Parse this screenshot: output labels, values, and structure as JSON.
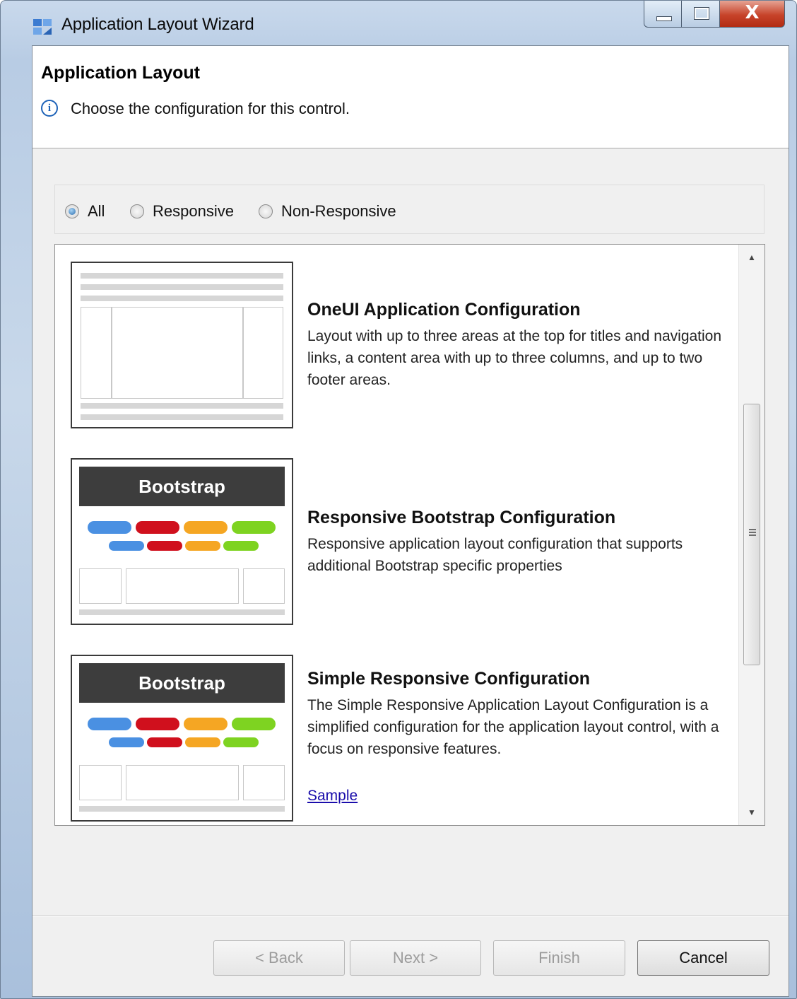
{
  "window": {
    "title": "Application Layout Wizard"
  },
  "caption": {
    "close_glyph": "X"
  },
  "header": {
    "title": "Application Layout",
    "info_glyph": "i",
    "message": "Choose the configuration for this control."
  },
  "filter": {
    "options": [
      {
        "label": "All",
        "selected": true
      },
      {
        "label": "Responsive",
        "selected": false
      },
      {
        "label": "Non-Responsive",
        "selected": false
      }
    ]
  },
  "configurations": [
    {
      "title": "OneUI Application Configuration",
      "description": "Layout with up to three areas at the top for titles and navigation links, a content area with up to three columns, and up to two footer areas.",
      "thumbnail": "oneui-layout-thumbnail"
    },
    {
      "title": "Responsive Bootstrap Configuration",
      "description": "Responsive application layout configuration that supports additional Bootstrap specific properties",
      "thumbnail_label": "Bootstrap"
    },
    {
      "title": "Simple Responsive Configuration",
      "description": "The Simple Responsive Application Layout Configuration is a simplified configuration for the application layout control, with a focus on responsive features.",
      "thumbnail_label": "Bootstrap",
      "link": "Sample"
    }
  ],
  "pill_colors": [
    "#4a90e2",
    "#d0101d",
    "#f5a623",
    "#7ed321"
  ],
  "buttons": {
    "back": "< Back",
    "next": "Next >",
    "finish": "Finish",
    "cancel": "Cancel"
  }
}
